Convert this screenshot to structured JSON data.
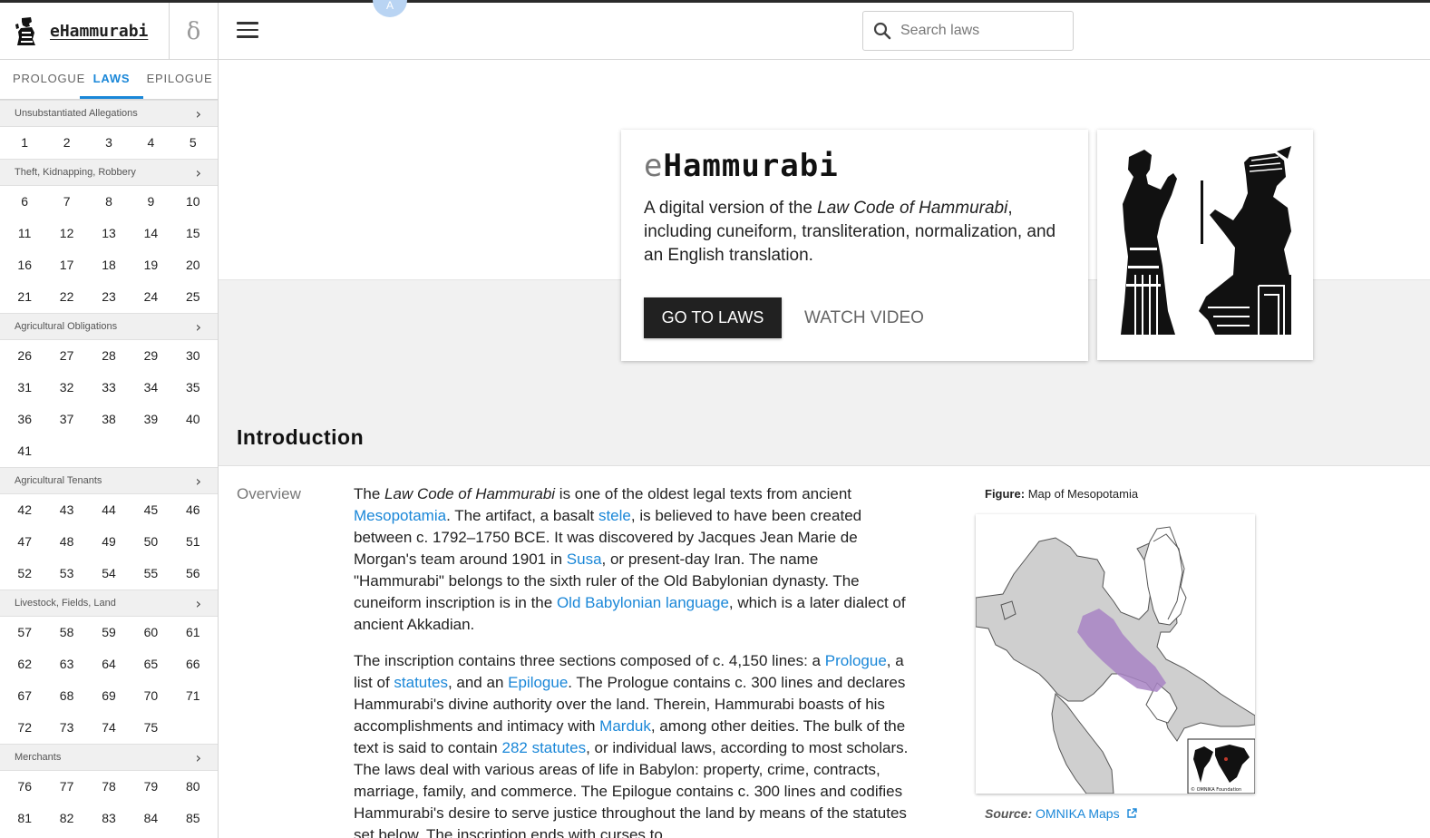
{
  "brand": {
    "name": "eHammurabi",
    "delta": "δ"
  },
  "tabs": [
    "PROLOGUE",
    "LAWS",
    "EPILOGUE"
  ],
  "active_tab": "LAWS",
  "categories": [
    {
      "title": "Unsubstantiated Allegations",
      "rows": [
        [
          "1",
          "2",
          "3",
          "4",
          "5"
        ]
      ]
    },
    {
      "title": "Theft, Kidnapping, Robbery",
      "rows": [
        [
          "6",
          "7",
          "8",
          "9",
          "10"
        ],
        [
          "11",
          "12",
          "13",
          "14",
          "15"
        ],
        [
          "16",
          "17",
          "18",
          "19",
          "20"
        ],
        [
          "21",
          "22",
          "23",
          "24",
          "25"
        ]
      ]
    },
    {
      "title": "Agricultural Obligations",
      "rows": [
        [
          "26",
          "27",
          "28",
          "29",
          "30"
        ],
        [
          "31",
          "32",
          "33",
          "34",
          "35"
        ],
        [
          "36",
          "37",
          "38",
          "39",
          "40"
        ],
        [
          "41"
        ]
      ]
    },
    {
      "title": "Agricultural Tenants",
      "rows": [
        [
          "42",
          "43",
          "44",
          "45",
          "46"
        ],
        [
          "47",
          "48",
          "49",
          "50",
          "51"
        ],
        [
          "52",
          "53",
          "54",
          "55",
          "56"
        ]
      ]
    },
    {
      "title": "Livestock, Fields, Land",
      "rows": [
        [
          "57",
          "58",
          "59",
          "60",
          "61"
        ],
        [
          "62",
          "63",
          "64",
          "65",
          "66"
        ],
        [
          "67",
          "68",
          "69",
          "70",
          "71"
        ],
        [
          "72",
          "73",
          "74",
          "75"
        ]
      ]
    },
    {
      "title": "Merchants",
      "rows": [
        [
          "76",
          "77",
          "78",
          "79",
          "80"
        ],
        [
          "81",
          "82",
          "83",
          "84",
          "85"
        ]
      ]
    }
  ],
  "search": {
    "placeholder": "Search laws"
  },
  "hero": {
    "title_prefix": "e",
    "title_main": "Hammurabi",
    "desc_before": "A digital version of the ",
    "desc_italic": "Law Code of Hammurabi",
    "desc_after": ", including cuneiform, transliteration, normalization, and an English translation.",
    "btn_laws": "GO TO LAWS",
    "btn_video": "WATCH VIDEO"
  },
  "intro": {
    "heading": "Introduction",
    "overview_label": "Overview",
    "p1": [
      {
        "t": "The "
      },
      {
        "t": "Law Code of Hammurabi",
        "i": true
      },
      {
        "t": " is one of the oldest legal texts from ancient "
      },
      {
        "t": "Mesopotamia",
        "link": true
      },
      {
        "t": ". The artifact, a basalt "
      },
      {
        "t": "stele",
        "link": true
      },
      {
        "t": ", is believed to have been created between c. 1792–1750 BCE. It was discovered by Jacques Jean Marie de Morgan's team around 1901 in "
      },
      {
        "t": "Susa",
        "link": true
      },
      {
        "t": ", or present-day Iran. The name \"Hammurabi\" belongs to the sixth ruler of the Old Babylonian dynasty. The cuneiform inscription is in the "
      },
      {
        "t": "Old Babylonian language",
        "link": true
      },
      {
        "t": ", which is a later dialect of ancient Akkadian."
      }
    ],
    "p2": [
      {
        "t": "The inscription contains three sections composed of c. 4,150 lines: a "
      },
      {
        "t": "Prologue",
        "link": true
      },
      {
        "t": ", a list of "
      },
      {
        "t": "statutes",
        "link": true
      },
      {
        "t": ", and an "
      },
      {
        "t": "Epilogue",
        "link": true
      },
      {
        "t": ". The Prologue contains c. 300 lines and declares Hammurabi's divine authority over the land. Therein, Hammurabi boasts of his accomplishments and intimacy with "
      },
      {
        "t": "Marduk",
        "link": true
      },
      {
        "t": ", among other deities. The bulk of the text is said to contain "
      },
      {
        "t": "282 statutes",
        "link": true
      },
      {
        "t": ", or individual laws, according to most scholars. The laws deal with various areas of life in Babylon: property, crime, contracts, marriage, family, and commerce. The Epilogue contains c. 300 lines and codifies Hammurabi's desire to serve justice throughout the land by means of the statutes set below. The inscription ends with curses to"
      }
    ],
    "figure_label": "Figure:",
    "figure_caption": "Map of Mesopotamia",
    "map_credit": "© OMNIKA Foundation",
    "source_label": "Source:",
    "source_link": "OMNIKA Maps",
    "source_icon": "external-link-icon"
  },
  "colors": {
    "accent": "#1a87d8",
    "dark_button": "#212121",
    "hero_band": "#f1f1f1",
    "map_highlight": "#a884c4"
  }
}
